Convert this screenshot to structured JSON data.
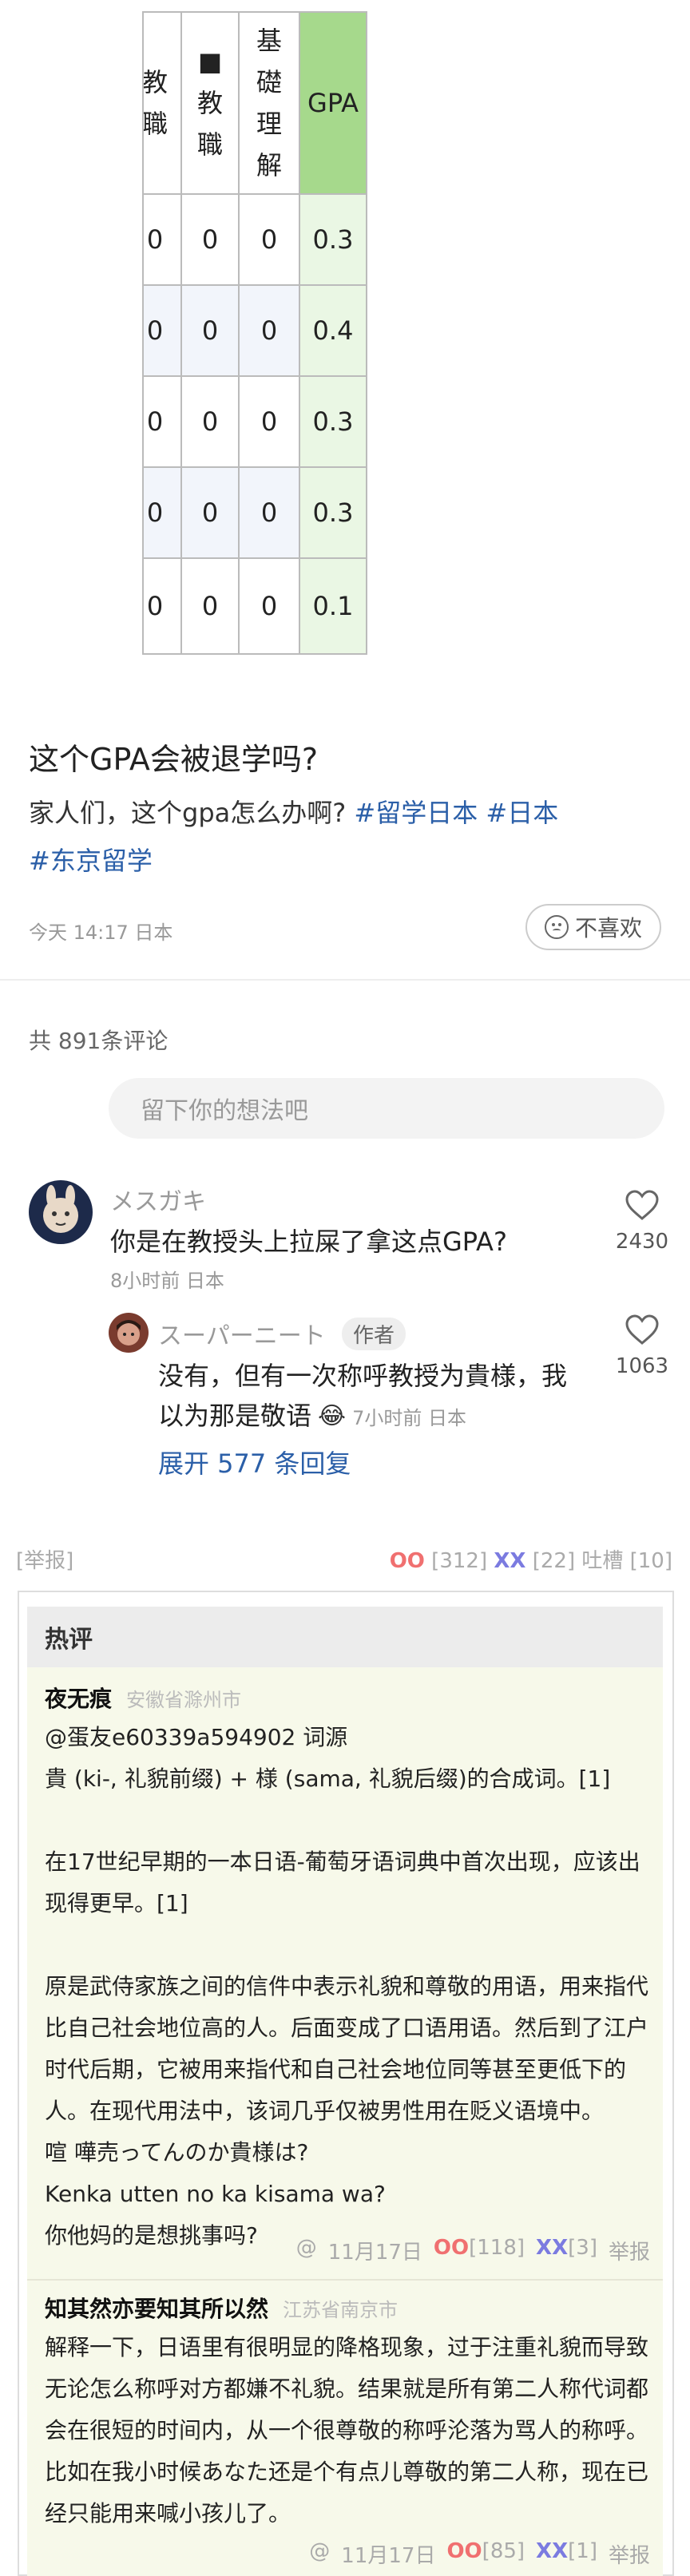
{
  "table": {
    "headers": [
      "教\n職",
      "■\n教\n職",
      "基\n礎\n理\n解",
      "GPA"
    ],
    "rows": [
      [
        "0",
        "0",
        "0",
        "0.3"
      ],
      [
        "0",
        "0",
        "0",
        "0.4"
      ],
      [
        "0",
        "0",
        "0",
        "0.3"
      ],
      [
        "0",
        "0",
        "0",
        "0.3"
      ],
      [
        "0",
        "0",
        "0",
        "0.1"
      ]
    ]
  },
  "post": {
    "title": "这个GPA会被退学吗?",
    "body": "家人们，这个gpa怎么办啊?",
    "tags": [
      "#留学日本",
      "#日本",
      "#东京留学"
    ],
    "time": "今天 14:17 日本",
    "dislike_label": "不喜欢"
  },
  "comments_section": {
    "count_label": "共 891条评论",
    "input_placeholder": "留下你的想法吧"
  },
  "comment1": {
    "username": "メスガキ",
    "text": "你是在教授头上拉屎了拿这点GPA?",
    "meta": "8小时前 日本",
    "likes": "2430"
  },
  "reply1": {
    "username": "スーパーニート",
    "badge": "作者",
    "text_line1": "没有，但有一次称呼教授为貴様，我",
    "text_line2": "以为那是敬语",
    "emoji": "😂",
    "meta": "7小时前 日本",
    "likes": "1063"
  },
  "expand_label": "展开 577 条回复",
  "report_row": {
    "report": "[举报]",
    "oo": "OO",
    "oo_count": "[312]",
    "xx": "XX",
    "xx_count": "[22]",
    "tucao": "吐槽 [10]"
  },
  "hot": {
    "header": "热评",
    "reviews": [
      {
        "name": "夜无痕",
        "location": "安徽省滁州市",
        "text": "@蛋友e60339a594902 词源\n貴 (ki-, 礼貌前缀) + 様 (sama, 礼貌后缀)的合成词。[1]\n\n在17世纪早期的一本日语-葡萄牙语词典中首次出现，应该出\n现得更早。[1]\n\n原是武侍家族之间的信件中表示礼貌和尊敬的用语，用来指代\n比自己社会地位高的人。后面变成了口语用语。然后到了江户\n时代后期，它被用来指代和自己社会地位同等甚至更低下的\n人。在现代用法中，该词几乎仅被男性用在贬义语境中。\n喧 嘩売ってんのか貴様は?\nKenka utten no ka kisama wa?\n你他妈的是想挑事吗?",
        "footer_at": "@",
        "date": "11月17日",
        "oo": "OO",
        "oo_count": "[118]",
        "xx": "XX",
        "xx_count": "[3]",
        "report": "举报"
      },
      {
        "name": "知其然亦要知其所以然",
        "location": "江苏省南京市",
        "text": "解释一下，日语里有很明显的降格现象，过于注重礼貌而导致\n无论怎么称呼对方都嫌不礼貌。结果就是所有第二人称代词都\n会在很短的时间内，从一个很尊敬的称呼沦落为骂人的称呼。\n比如在我小时候あなた还是个有点儿尊敬的第二人称，现在已\n经只能用来喊小孩儿了。",
        "footer_at": "@",
        "date": "11月17日",
        "oo": "OO",
        "oo_count": "[85]",
        "xx": "XX",
        "xx_count": "[1]",
        "report": "举报"
      }
    ]
  }
}
